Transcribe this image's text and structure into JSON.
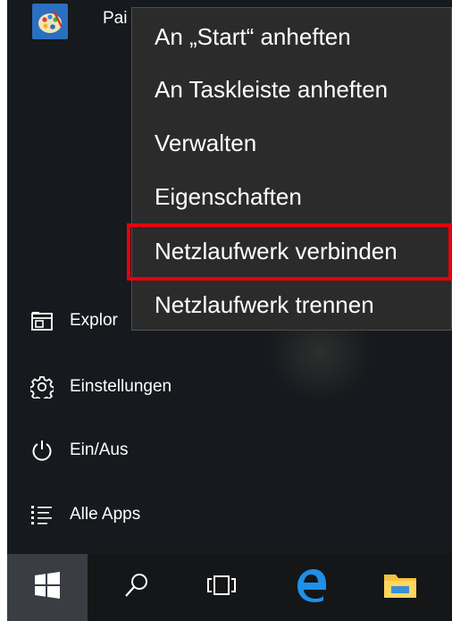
{
  "pinned": {
    "label": "Pai",
    "icon": "paint-palette-icon"
  },
  "context_menu": {
    "items": [
      "An „Start“ anheften",
      "An Taskleiste anheften",
      "Verwalten",
      "Eigenschaften",
      "Netzlaufwerk verbinden",
      "Netzlaufwerk trennen"
    ],
    "highlighted_index": 4,
    "highlight_color": "#e8000b"
  },
  "left_menu": {
    "explorer": {
      "label": "Explor",
      "icon": "file-explorer-icon"
    },
    "settings": {
      "label": "Einstellungen",
      "icon": "gear-icon"
    },
    "power": {
      "label": "Ein/Aus",
      "icon": "power-icon"
    },
    "all_apps": {
      "label": "Alle Apps",
      "icon": "list-icon"
    }
  },
  "taskbar": {
    "items": [
      "windows-start-icon",
      "search-icon",
      "task-view-icon",
      "edge-icon",
      "folder-icon"
    ]
  },
  "colors": {
    "panel_bg": "#16191d",
    "menu_bg": "#2b2b2b",
    "taskbar_bg": "#141618",
    "edge_blue": "#1e90e6",
    "folder_yellow": "#f5c242"
  }
}
